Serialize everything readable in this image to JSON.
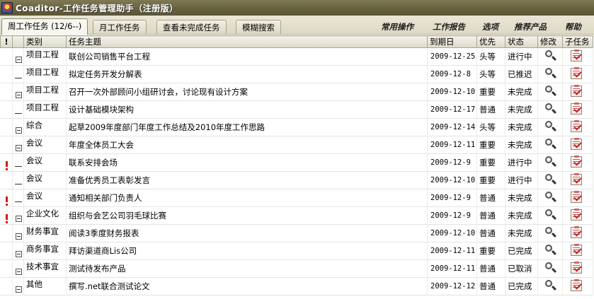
{
  "window": {
    "title": "Coaditor-工作任务管理助手（注册版）"
  },
  "tabs": [
    {
      "label": "周工作任务 (12/6--)"
    },
    {
      "label": "月工作任务"
    },
    {
      "label": "查看未完成任务"
    },
    {
      "label": "模糊搜索"
    }
  ],
  "menu": [
    {
      "label": "常用操作"
    },
    {
      "label": "工作报告"
    },
    {
      "label": "选项"
    },
    {
      "label": "推荐产品"
    },
    {
      "label": "帮助"
    }
  ],
  "columns": {
    "flag": "!",
    "category": "类别",
    "subject": "任务主题",
    "due": "到期日",
    "priority": "优先",
    "status": "状态",
    "edit": "修改",
    "subtask": "子任务"
  },
  "icons": {
    "flag": "exclamation-icon",
    "collapse": "tree-collapse-icon",
    "edit": "magnifier-icon",
    "subtask": "clipboard-check-icon"
  },
  "rows": [
    {
      "flag": false,
      "tree": "box",
      "category": "项目工程",
      "subject": "联创公司销售平台工程",
      "due": "2009-12-25",
      "priority": "头等",
      "status": "进行中"
    },
    {
      "flag": false,
      "tree": "dash",
      "category": "项目工程",
      "subject": "拟定任务开发分解表",
      "due": "2009-12-8",
      "priority": "头等",
      "status": "已推迟"
    },
    {
      "flag": false,
      "tree": "box",
      "category": "项目工程",
      "subject": "召开一次外部顾问小组研讨会，讨论现有设计方案",
      "due": "2009-12-10",
      "priority": "重要",
      "status": "未完成"
    },
    {
      "flag": false,
      "tree": "dash",
      "category": "项目工程",
      "subject": "设计基础模块架构",
      "due": "2009-12-17",
      "priority": "普通",
      "status": "未完成"
    },
    {
      "flag": false,
      "tree": "box",
      "category": "综合",
      "subject": "起草2009年度部门年度工作总结及2010年度工作思路",
      "due": "2009-12-14",
      "priority": "头等",
      "status": "未完成"
    },
    {
      "flag": false,
      "tree": "box",
      "category": "会议",
      "subject": "年度全体员工大会",
      "due": "2009-12-11",
      "priority": "重要",
      "status": "未完成"
    },
    {
      "flag": true,
      "tree": "dash",
      "category": "会议",
      "subject": "联系安排会场",
      "due": "2009-12-9",
      "priority": "重要",
      "status": "进行中"
    },
    {
      "flag": false,
      "tree": "dash",
      "category": "会议",
      "subject": "准备优秀员工表彰发言",
      "due": "2009-12-10",
      "priority": "重要",
      "status": "进行中"
    },
    {
      "flag": true,
      "tree": "dash",
      "category": "会议",
      "subject": "通知相关部门负责人",
      "due": "2009-12-9",
      "priority": "普通",
      "status": "未完成"
    },
    {
      "flag": true,
      "tree": "box",
      "category": "企业文化",
      "subject": "组织与会艺公司羽毛球比赛",
      "due": "2009-12-9",
      "priority": "普通",
      "status": "未完成"
    },
    {
      "flag": false,
      "tree": "box",
      "category": "财务事宜",
      "subject": "阅读3季度财务报表",
      "due": "2009-12-10",
      "priority": "普通",
      "status": "未完成"
    },
    {
      "flag": false,
      "tree": "box",
      "category": "商务事宜",
      "subject": "拜访渠道商Lis公司",
      "due": "2009-12-11",
      "priority": "重要",
      "status": "已完成"
    },
    {
      "flag": false,
      "tree": "box",
      "category": "技术事宜",
      "subject": "测试待发布产品",
      "due": "2009-12-11",
      "priority": "普通",
      "status": "已取消"
    },
    {
      "flag": false,
      "tree": "box",
      "category": "其他",
      "subject": "撰写.net联合测试论文",
      "due": "2009-12-12",
      "priority": "普通",
      "status": "已完成"
    }
  ]
}
